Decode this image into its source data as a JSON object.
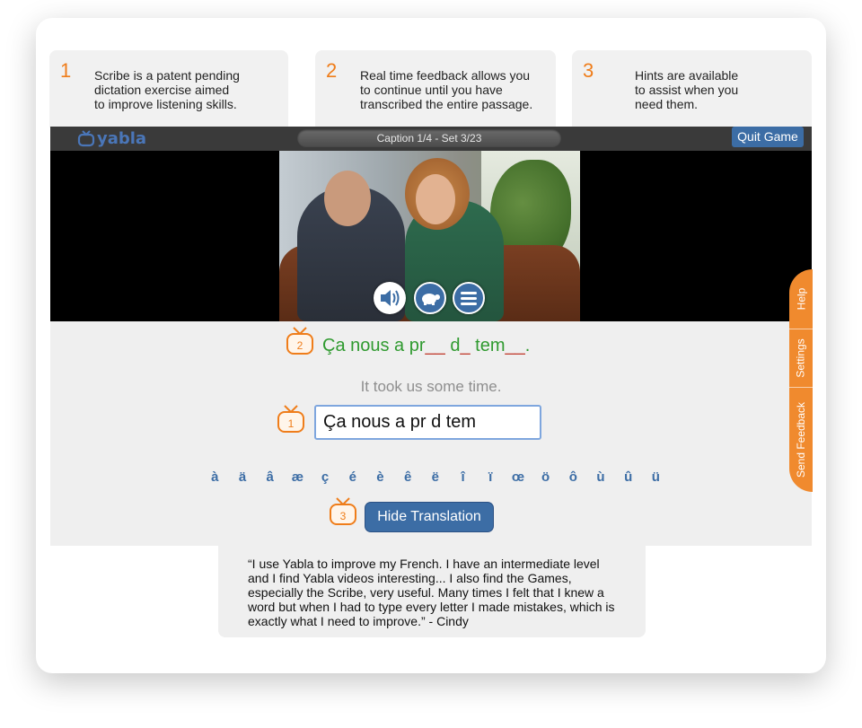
{
  "steps": [
    {
      "number": "1",
      "text": "Scribe is a patent pending\ndictation exercise aimed\nto improve listening skills."
    },
    {
      "number": "2",
      "text": "Real time feedback allows you\nto continue until you have\ntranscribed the entire passage."
    },
    {
      "number": "3",
      "text": "Hints are available\nto assist when you\nneed them."
    }
  ],
  "header": {
    "logo": "yabla",
    "caption_status": "Caption 1/4 - Set 3/23",
    "quit_label": "Quit Game"
  },
  "video": {
    "controls": [
      "speaker-icon",
      "turtle-icon",
      "menu-icon"
    ]
  },
  "feedback": {
    "markers": [
      "1",
      "2",
      "3"
    ],
    "sentence_parts": [
      {
        "text": "Ça nous a ",
        "state": "correct"
      },
      {
        "text": "pr",
        "state": "correct"
      },
      {
        "text": "__",
        "state": "missing"
      },
      {
        "text": " ",
        "state": "space"
      },
      {
        "text": "d",
        "state": "correct"
      },
      {
        "text": "_",
        "state": "missing"
      },
      {
        "text": " ",
        "state": "space"
      },
      {
        "text": "tem",
        "state": "correct"
      },
      {
        "text": "__",
        "state": "missing"
      },
      {
        "text": ".",
        "state": "correct"
      }
    ],
    "translation": "It took us some time.",
    "input_value": "Ça nous a pr d tem"
  },
  "special_characters": [
    "à",
    "ä",
    "â",
    "æ",
    "ç",
    "é",
    "è",
    "ê",
    "ë",
    "î",
    "ï",
    "œ",
    "ö",
    "ô",
    "ù",
    "û",
    "ü"
  ],
  "hide_translation_label": "Hide Translation",
  "side_tabs": [
    "Help",
    "Settings",
    "Send Feedback"
  ],
  "testimonial": "“I use Yabla to improve my French. I have an intermediate level and I find Yabla videos interesting... I also find the Games, especially the Scribe, very useful. Many times I felt that I knew a word but when I had to type every letter I made mistakes, which is exactly what I need to improve.” - Cindy",
  "colors": {
    "accent_orange": "#ef7d1a",
    "brand_blue": "#3c6da5",
    "correct_green": "#2f9a2f",
    "missing_red": "#c0392b"
  }
}
